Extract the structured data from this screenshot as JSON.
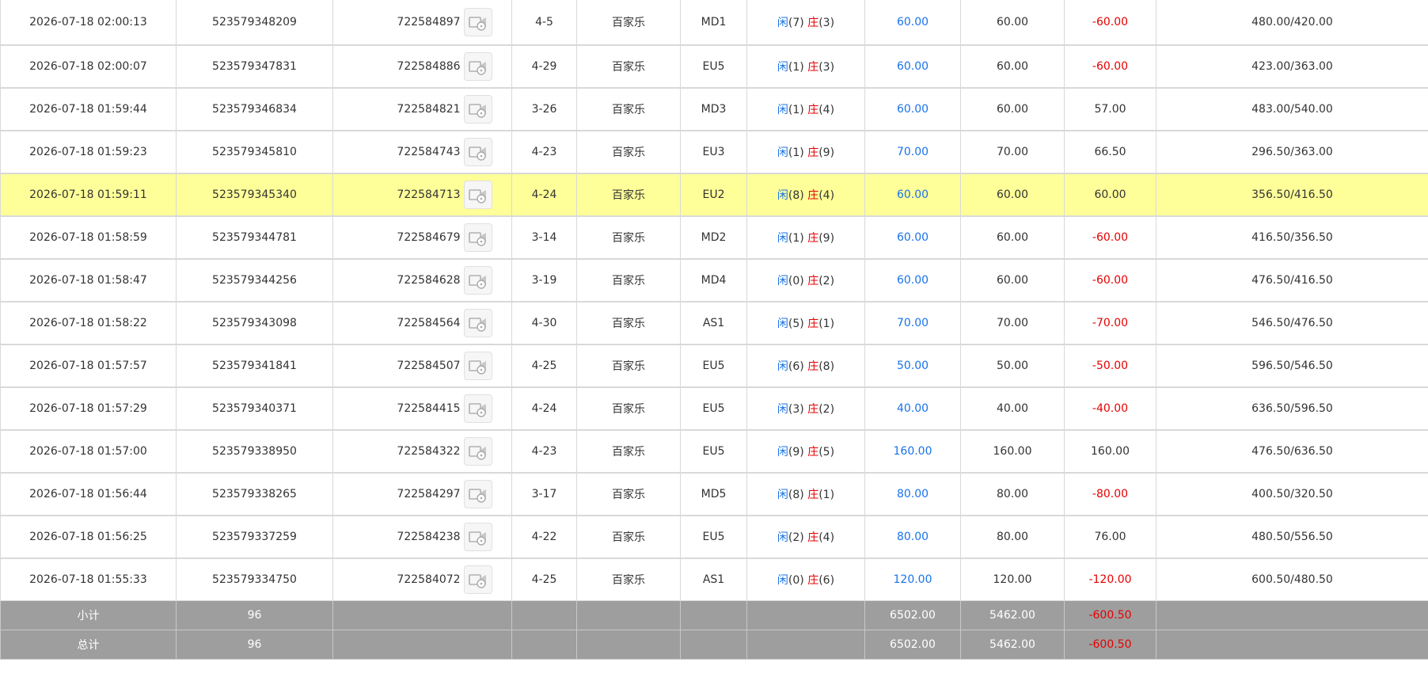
{
  "rows": [
    {
      "time": "2026-07-18 02:00:13",
      "bet_id": "523579348209",
      "round_id": "722584897",
      "shoe": "4-5",
      "game": "百家乐",
      "table": "MD1",
      "idle_label": "闲",
      "idle_n": "(7)",
      "bank_label": "庄",
      "bank_n": "(3)",
      "bet": "60.00",
      "valid": "60.00",
      "winloss": "-60.00",
      "neg": true,
      "balance": "480.00/420.00",
      "hl": false
    },
    {
      "time": "2026-07-18 02:00:07",
      "bet_id": "523579347831",
      "round_id": "722584886",
      "shoe": "4-29",
      "game": "百家乐",
      "table": "EU5",
      "idle_label": "闲",
      "idle_n": "(1)",
      "bank_label": "庄",
      "bank_n": "(3)",
      "bet": "60.00",
      "valid": "60.00",
      "winloss": "-60.00",
      "neg": true,
      "balance": "423.00/363.00",
      "hl": false
    },
    {
      "time": "2026-07-18 01:59:44",
      "bet_id": "523579346834",
      "round_id": "722584821",
      "shoe": "3-26",
      "game": "百家乐",
      "table": "MD3",
      "idle_label": "闲",
      "idle_n": "(1)",
      "bank_label": "庄",
      "bank_n": "(4)",
      "bet": "60.00",
      "valid": "60.00",
      "winloss": "57.00",
      "neg": false,
      "balance": "483.00/540.00",
      "hl": false
    },
    {
      "time": "2026-07-18 01:59:23",
      "bet_id": "523579345810",
      "round_id": "722584743",
      "shoe": "4-23",
      "game": "百家乐",
      "table": "EU3",
      "idle_label": "闲",
      "idle_n": "(1)",
      "bank_label": "庄",
      "bank_n": "(9)",
      "bet": "70.00",
      "valid": "70.00",
      "winloss": "66.50",
      "neg": false,
      "balance": "296.50/363.00",
      "hl": false
    },
    {
      "time": "2026-07-18 01:59:11",
      "bet_id": "523579345340",
      "round_id": "722584713",
      "shoe": "4-24",
      "game": "百家乐",
      "table": "EU2",
      "idle_label": "闲",
      "idle_n": "(8)",
      "bank_label": "庄",
      "bank_n": "(4)",
      "bet": "60.00",
      "valid": "60.00",
      "winloss": "60.00",
      "neg": false,
      "balance": "356.50/416.50",
      "hl": true
    },
    {
      "time": "2026-07-18 01:58:59",
      "bet_id": "523579344781",
      "round_id": "722584679",
      "shoe": "3-14",
      "game": "百家乐",
      "table": "MD2",
      "idle_label": "闲",
      "idle_n": "(1)",
      "bank_label": "庄",
      "bank_n": "(9)",
      "bet": "60.00",
      "valid": "60.00",
      "winloss": "-60.00",
      "neg": true,
      "balance": "416.50/356.50",
      "hl": false
    },
    {
      "time": "2026-07-18 01:58:47",
      "bet_id": "523579344256",
      "round_id": "722584628",
      "shoe": "3-19",
      "game": "百家乐",
      "table": "MD4",
      "idle_label": "闲",
      "idle_n": "(0)",
      "bank_label": "庄",
      "bank_n": "(2)",
      "bet": "60.00",
      "valid": "60.00",
      "winloss": "-60.00",
      "neg": true,
      "balance": "476.50/416.50",
      "hl": false
    },
    {
      "time": "2026-07-18 01:58:22",
      "bet_id": "523579343098",
      "round_id": "722584564",
      "shoe": "4-30",
      "game": "百家乐",
      "table": "AS1",
      "idle_label": "闲",
      "idle_n": "(5)",
      "bank_label": "庄",
      "bank_n": "(1)",
      "bet": "70.00",
      "valid": "70.00",
      "winloss": "-70.00",
      "neg": true,
      "balance": "546.50/476.50",
      "hl": false
    },
    {
      "time": "2026-07-18 01:57:57",
      "bet_id": "523579341841",
      "round_id": "722584507",
      "shoe": "4-25",
      "game": "百家乐",
      "table": "EU5",
      "idle_label": "闲",
      "idle_n": "(6)",
      "bank_label": "庄",
      "bank_n": "(8)",
      "bet": "50.00",
      "valid": "50.00",
      "winloss": "-50.00",
      "neg": true,
      "balance": "596.50/546.50",
      "hl": false
    },
    {
      "time": "2026-07-18 01:57:29",
      "bet_id": "523579340371",
      "round_id": "722584415",
      "shoe": "4-24",
      "game": "百家乐",
      "table": "EU5",
      "idle_label": "闲",
      "idle_n": "(3)",
      "bank_label": "庄",
      "bank_n": "(2)",
      "bet": "40.00",
      "valid": "40.00",
      "winloss": "-40.00",
      "neg": true,
      "balance": "636.50/596.50",
      "hl": false
    },
    {
      "time": "2026-07-18 01:57:00",
      "bet_id": "523579338950",
      "round_id": "722584322",
      "shoe": "4-23",
      "game": "百家乐",
      "table": "EU5",
      "idle_label": "闲",
      "idle_n": "(9)",
      "bank_label": "庄",
      "bank_n": "(5)",
      "bet": "160.00",
      "valid": "160.00",
      "winloss": "160.00",
      "neg": false,
      "balance": "476.50/636.50",
      "hl": false
    },
    {
      "time": "2026-07-18 01:56:44",
      "bet_id": "523579338265",
      "round_id": "722584297",
      "shoe": "3-17",
      "game": "百家乐",
      "table": "MD5",
      "idle_label": "闲",
      "idle_n": "(8)",
      "bank_label": "庄",
      "bank_n": "(1)",
      "bet": "80.00",
      "valid": "80.00",
      "winloss": "-80.00",
      "neg": true,
      "balance": "400.50/320.50",
      "hl": false
    },
    {
      "time": "2026-07-18 01:56:25",
      "bet_id": "523579337259",
      "round_id": "722584238",
      "shoe": "4-22",
      "game": "百家乐",
      "table": "EU5",
      "idle_label": "闲",
      "idle_n": "(2)",
      "bank_label": "庄",
      "bank_n": "(4)",
      "bet": "80.00",
      "valid": "80.00",
      "winloss": "76.00",
      "neg": false,
      "balance": "480.50/556.50",
      "hl": false
    },
    {
      "time": "2026-07-18 01:55:33",
      "bet_id": "523579334750",
      "round_id": "722584072",
      "shoe": "4-25",
      "game": "百家乐",
      "table": "AS1",
      "idle_label": "闲",
      "idle_n": "(0)",
      "bank_label": "庄",
      "bank_n": "(6)",
      "bet": "120.00",
      "valid": "120.00",
      "winloss": "-120.00",
      "neg": true,
      "balance": "600.50/480.50",
      "hl": false
    }
  ],
  "totals": [
    {
      "label": "小计",
      "count": "96",
      "bet": "6502.00",
      "valid": "5462.00",
      "winloss": "-600.50"
    },
    {
      "label": "总计",
      "count": "96",
      "bet": "6502.00",
      "valid": "5462.00",
      "winloss": "-600.50"
    }
  ],
  "icons": {
    "video": "video-replay-icon"
  },
  "colors": {
    "highlight": "#ffff99",
    "negative": "#e60000",
    "blue": "#1a73e8",
    "total_bg": "#9e9e9e"
  }
}
